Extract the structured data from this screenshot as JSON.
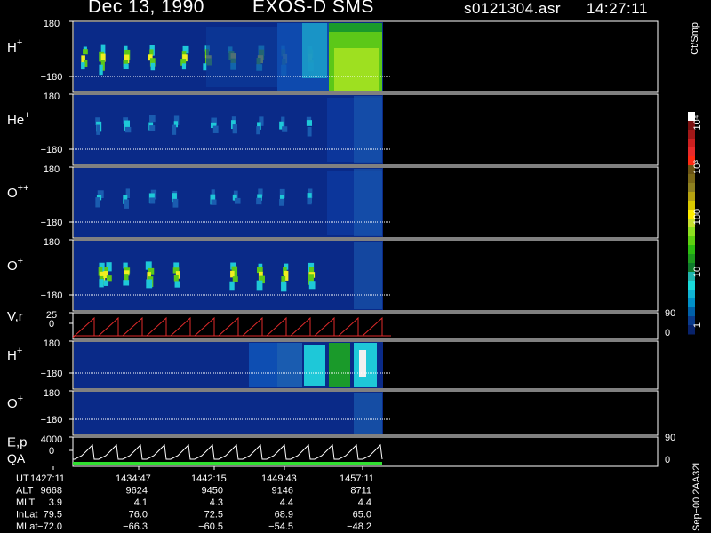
{
  "header": {
    "date": "Dec 13, 1990",
    "instrument": "EXOS-D SMS",
    "file": "s0121304.asr",
    "time": "14:27:11"
  },
  "colorbar": {
    "unit_label": "Ct/Smp",
    "tick_labels": [
      "10⁴",
      "10³",
      "100",
      "10",
      "1"
    ],
    "colors": [
      "#ffffff",
      "#7a1010",
      "#a11818",
      "#cc2020",
      "#e82a2a",
      "#ff2a12",
      "#6b5414",
      "#7c6918",
      "#8e8020",
      "#b6a210",
      "#d9c800",
      "#ffee00",
      "#c8e030",
      "#8ee020",
      "#5ed010",
      "#2cbc10",
      "#1d9a1d",
      "#0f7a2c",
      "#21b4ae",
      "#19dada",
      "#10b4d4",
      "#0090c8",
      "#0060a8",
      "#0a3a8a",
      "#08226a"
    ]
  },
  "panels": [
    {
      "id": "h-plus",
      "label": "H",
      "sup": "+",
      "top_tick": "180",
      "bottom_tick": "−180"
    },
    {
      "id": "he-plus",
      "label": "He",
      "sup": "+",
      "top_tick": "180",
      "bottom_tick": "−180"
    },
    {
      "id": "o-pp",
      "label": "O",
      "sup": "++",
      "top_tick": "180",
      "bottom_tick": "−180"
    },
    {
      "id": "o-plus",
      "label": "O",
      "sup": "+",
      "top_tick": "180",
      "bottom_tick": "−180"
    },
    {
      "id": "vr",
      "label": "V,r",
      "sup": "",
      "top_tick": "25",
      "bottom_tick": "0",
      "right_top": "90",
      "right_bottom": "0"
    },
    {
      "id": "h-plus-2",
      "label": "H",
      "sup": "+",
      "top_tick": "180",
      "bottom_tick": "−180"
    },
    {
      "id": "o-plus-2",
      "label": "O",
      "sup": "+",
      "top_tick": "180",
      "bottom_tick": "−180"
    },
    {
      "id": "ep",
      "label": "E,p",
      "label2": "QA",
      "sup": "",
      "top_tick": "4000",
      "bottom_tick": "0",
      "right_top": "90",
      "right_bottom": "0"
    }
  ],
  "footer": {
    "row_labels": [
      "UT",
      "ALT",
      "MLT",
      "InLat",
      "MLat"
    ],
    "columns": [
      [
        "1427:11",
        "9668",
        "3.9",
        "79.5",
        "−72.0"
      ],
      [
        "1434:47",
        "9624",
        "4.1",
        "76.0",
        "−66.3"
      ],
      [
        "1442:15",
        "9450",
        "4.3",
        "72.5",
        "−60.5"
      ],
      [
        "1449:43",
        "9146",
        "4.4",
        "68.9",
        "−54.5"
      ],
      [
        "1457:11",
        "8711",
        "4.4",
        "65.0",
        "−48.2"
      ]
    ],
    "side_label": "Sep−00 2AA32L"
  },
  "chart_data": {
    "type": "heatmap",
    "title": "Dec 13, 1990    EXOS-D SMS",
    "x_tick_labels": [
      "1427:11",
      "1434:47",
      "1442:15",
      "1449:43",
      "1457:11"
    ],
    "colorbar_ticks": [
      "1",
      "10",
      "100",
      "10³",
      "10⁴"
    ],
    "colorbar_unit": "Ct/Smp",
    "series": [
      {
        "name": "H+",
        "y_range": [
          -180,
          180
        ],
        "data_extent_frac": 0.61
      },
      {
        "name": "He+",
        "y_range": [
          -180,
          180
        ],
        "data_extent_frac": 0.61
      },
      {
        "name": "O++",
        "y_range": [
          -180,
          180
        ],
        "data_extent_frac": 0.61
      },
      {
        "name": "O+",
        "y_range": [
          -180,
          180
        ],
        "data_extent_frac": 0.61
      },
      {
        "name": "V,r",
        "y_range": [
          0,
          25
        ],
        "right_range": [
          0,
          90
        ]
      },
      {
        "name": "H+",
        "y_range": [
          -180,
          180
        ],
        "data_extent_frac": 0.61
      },
      {
        "name": "O+",
        "y_range": [
          -180,
          180
        ],
        "data_extent_frac": 0.61
      },
      {
        "name": "E,p",
        "y_range": [
          0,
          4000
        ],
        "right_range": [
          0,
          90
        ]
      }
    ]
  }
}
